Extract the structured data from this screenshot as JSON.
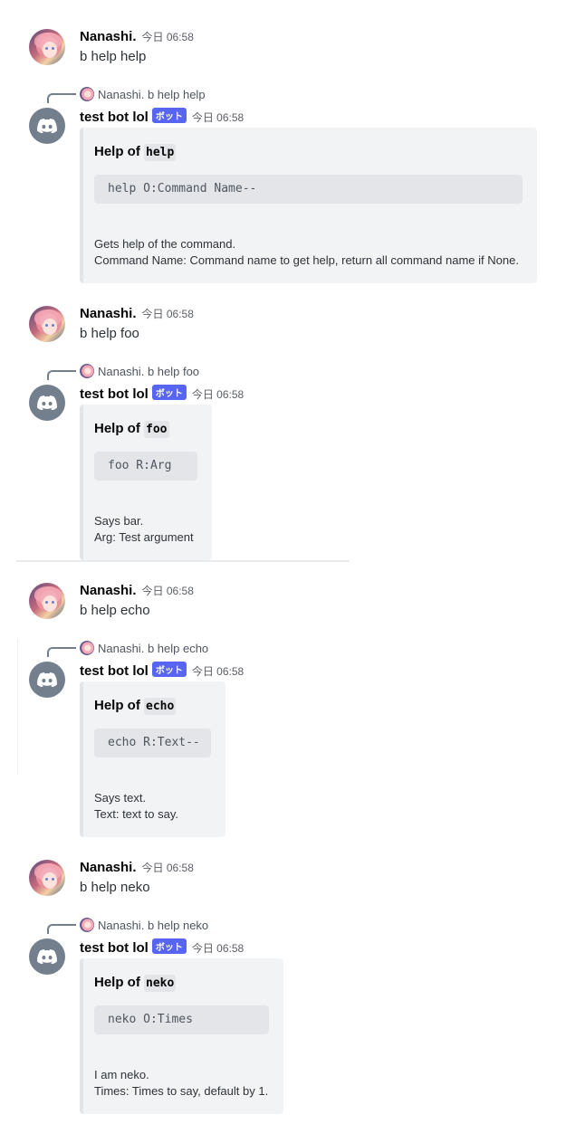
{
  "messages": [
    {
      "user": "Nanashi.",
      "time": "今日 06:58",
      "text": "b help help",
      "reply": {
        "ref_user": "Nanashi.",
        "ref_text": "b help help",
        "bot_name": "test bot lol",
        "bot_tag": "ボット",
        "time": "今日 06:58",
        "embed": {
          "title_prefix": "Help of",
          "title_code": "help",
          "code": "help O:Command Name--",
          "desc_line1": "Gets help of the command.",
          "desc_line2": "Command Name: Command name to get help, return all command name if None."
        }
      }
    },
    {
      "user": "Nanashi.",
      "time": "今日 06:58",
      "text": "b help foo",
      "reply": {
        "ref_user": "Nanashi.",
        "ref_text": "b help foo",
        "bot_name": "test bot lol",
        "bot_tag": "ボット",
        "time": "今日 06:58",
        "embed": {
          "title_prefix": "Help of",
          "title_code": "foo",
          "code": "foo R:Arg",
          "desc_line1": "Says bar.",
          "desc_line2": "Arg: Test argument"
        }
      }
    },
    {
      "user": "Nanashi.",
      "time": "今日 06:58",
      "text": "b help echo",
      "reply": {
        "ref_user": "Nanashi.",
        "ref_text": "b help echo",
        "bot_name": "test bot lol",
        "bot_tag": "ボット",
        "time": "今日 06:58",
        "embed": {
          "title_prefix": "Help of",
          "title_code": "echo",
          "code": "echo R:Text--",
          "desc_line1": "Says text.",
          "desc_line2": "Text: text to say."
        }
      }
    },
    {
      "user": "Nanashi.",
      "time": "今日 06:58",
      "text": "b help neko",
      "reply": {
        "ref_user": "Nanashi.",
        "ref_text": "b help neko",
        "bot_name": "test bot lol",
        "bot_tag": "ボット",
        "time": "今日 06:58",
        "embed": {
          "title_prefix": "Help of",
          "title_code": "neko",
          "code": "neko O:Times",
          "desc_line1": "I am neko.",
          "desc_line2": "Times: Times to say, default by 1."
        }
      }
    }
  ],
  "icons": {
    "user_avatar": "anime-avatar-icon",
    "bot_avatar": "discord-logo-icon"
  },
  "colors": {
    "bot_tag": "#5865f2",
    "embed_bg": "#f2f3f5",
    "bot_avatar_bg": "#747f8d"
  }
}
